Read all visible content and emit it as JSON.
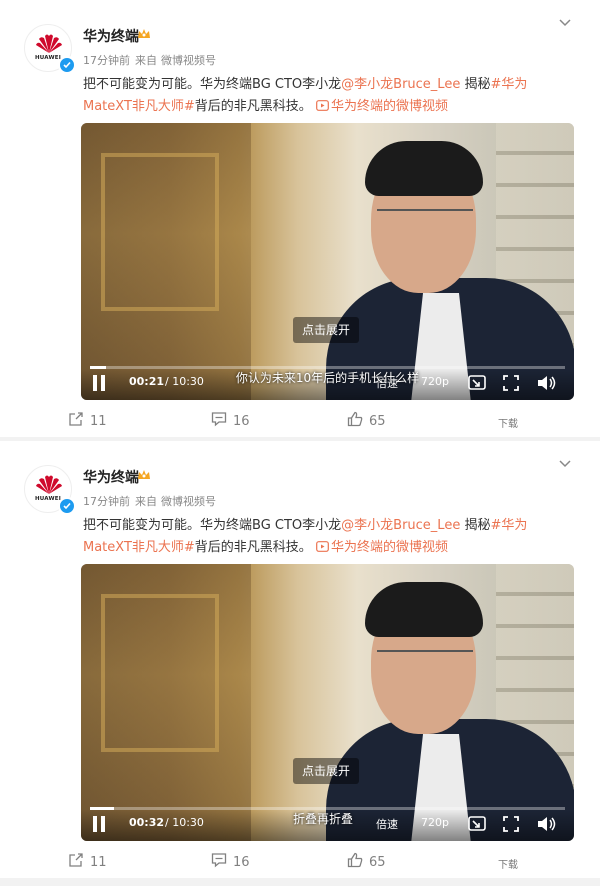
{
  "posts": [
    {
      "author": "华为终端",
      "time": "17分钟前",
      "source_prefix": "来自",
      "source": "微博视频号",
      "avatar_brand": "HUAWEI",
      "text_parts": [
        {
          "text": "把不可能变为可能。华为终端BG CTO李小龙",
          "link": false
        },
        {
          "text": "@李小龙Bruce_Lee",
          "link": true
        },
        {
          "text": " 揭秘",
          "link": false
        },
        {
          "text": "#华为MateXT非凡大师#",
          "link": true
        },
        {
          "text": "背后的非凡黑科技。 ",
          "link": false
        },
        {
          "text": "华为终端的微博视频",
          "link": true
        }
      ],
      "video": {
        "expand_label": "点击展开",
        "subtitle": "你认为未来10年后的手机长什么样",
        "current_time": "00:21",
        "total_time": "/ 10:30",
        "progress": 0.033,
        "speed_label": "倍速",
        "quality_label": "720p"
      },
      "actions": {
        "reposts": "11",
        "comments": "16",
        "likes": "65",
        "download": "下载"
      }
    },
    {
      "author": "华为终端",
      "time": "17分钟前",
      "source_prefix": "来自",
      "source": "微博视频号",
      "avatar_brand": "HUAWEI",
      "text_parts": [
        {
          "text": "把不可能变为可能。华为终端BG CTO李小龙",
          "link": false
        },
        {
          "text": "@李小龙Bruce_Lee",
          "link": true
        },
        {
          "text": " 揭秘",
          "link": false
        },
        {
          "text": "#华为MateXT非凡大师#",
          "link": true
        },
        {
          "text": "背后的非凡黑科技。 ",
          "link": false
        },
        {
          "text": "华为终端的微博视频",
          "link": true
        }
      ],
      "video": {
        "expand_label": "点击展开",
        "subtitle": "折叠再折叠",
        "current_time": "00:32",
        "total_time": "/ 10:30",
        "progress": 0.051,
        "speed_label": "倍速",
        "quality_label": "720p"
      },
      "actions": {
        "reposts": "11",
        "comments": "16",
        "likes": "65",
        "download": "下载"
      }
    }
  ],
  "colors": {
    "link": "#eb7350",
    "verified": "#1d9bf0",
    "crown": "#f5a623"
  }
}
